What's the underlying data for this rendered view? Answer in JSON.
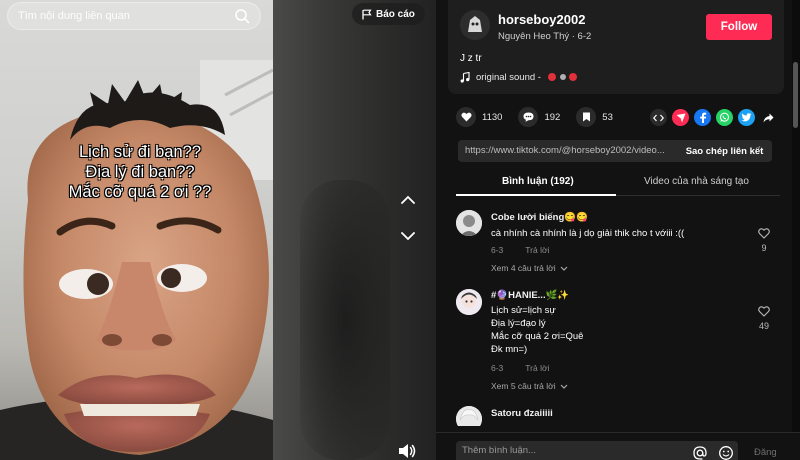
{
  "search": {
    "placeholder": "Tìm nội dung liên quan"
  },
  "report": {
    "label": "Báo cáo"
  },
  "video": {
    "caption_lines": [
      "Lịch sử đi bạn??",
      "Địa lý đi bạn??",
      "Mắc cỡ quá 2 ơi ??"
    ]
  },
  "author": {
    "username": "horseboy2002",
    "display_line": "Nguyên Heo Thý · 6-2",
    "follow_label": "Follow",
    "description": "J z tr",
    "sound": "original sound -"
  },
  "stats": {
    "likes": "1130",
    "comments": "192",
    "saves": "53"
  },
  "share_icons": [
    "embed-icon",
    "send-icon",
    "facebook-icon",
    "whatsapp-icon",
    "twitter-icon",
    "share-arrow-icon"
  ],
  "link": {
    "url": "https://www.tiktok.com/@horseboy2002/video...",
    "copy_label": "Sao chép liên kết"
  },
  "tabs": [
    {
      "label": "Bình luận (192)"
    },
    {
      "label": "Video của nhà sáng tạo"
    }
  ],
  "comments": [
    {
      "user": "Cobe lười biếng😋😋",
      "text": [
        "cà nhính cà nhính là j dọ giải thik cho t vớiii :(("
      ],
      "date": "6-3",
      "reply": "Trả lời",
      "likes": "9",
      "more_replies": "Xem 4 câu trả lời"
    },
    {
      "user": "#🔮HANIE...🌿✨",
      "text": [
        "Lịch sử=lịch sự",
        "Địa lý=đạo lý",
        "Mắc cỡ quá 2 ơi=Quê",
        "Đk mn=)"
      ],
      "date": "6-3",
      "reply": "Trả lời",
      "likes": "49",
      "more_replies": "Xem 5 câu trả lời"
    },
    {
      "user": "Satoru đzaiiiii",
      "text": [],
      "date": "",
      "reply": "",
      "likes": "",
      "more_replies": ""
    }
  ],
  "composer": {
    "placeholder": "Thêm bình luận...",
    "post_label": "Đăng"
  },
  "colors": {
    "accent": "#fe2c55",
    "panel_bg": "#121212",
    "card_bg": "#1e1e1e"
  }
}
